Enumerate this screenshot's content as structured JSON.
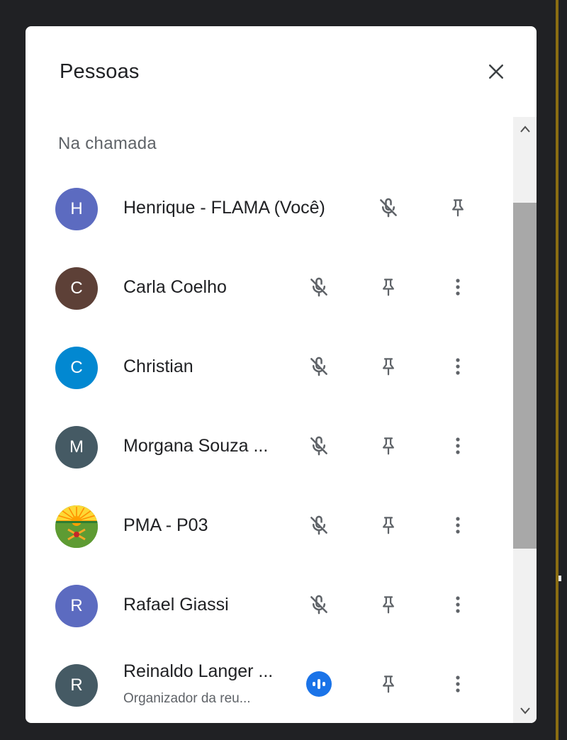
{
  "panel": {
    "title": "Pessoas",
    "section_label": "Na chamada"
  },
  "participants": [
    {
      "initial": "H",
      "name": "Henrique - FLAMA (Você)",
      "subtitle": "",
      "avatar_color": "#5c6bc0",
      "mic": "mic-off-icon",
      "has_more": false
    },
    {
      "initial": "C",
      "name": "Carla Coelho",
      "subtitle": "",
      "avatar_color": "#5d4037",
      "mic": "mic-off-icon",
      "has_more": true
    },
    {
      "initial": "C",
      "name": "Christian",
      "subtitle": "",
      "avatar_color": "#0288d1",
      "mic": "mic-off-icon",
      "has_more": true
    },
    {
      "initial": "M",
      "name": "Morgana Souza ...",
      "subtitle": "",
      "avatar_color": "#455a64",
      "mic": "mic-off-icon",
      "has_more": true
    },
    {
      "initial": "",
      "name": "PMA - P03",
      "subtitle": "",
      "avatar_color": "#5e9b33",
      "mic": "mic-off-icon",
      "has_more": true,
      "avatar_image": "emblem"
    },
    {
      "initial": "R",
      "name": "Rafael Giassi",
      "subtitle": "",
      "avatar_color": "#5c6bc0",
      "mic": "mic-off-icon",
      "has_more": true
    },
    {
      "initial": "R",
      "name": "Reinaldo Langer ...",
      "subtitle": "Organizador da reu...",
      "avatar_color": "#455a64",
      "mic": "speaking-icon",
      "has_more": true
    }
  ],
  "colors": {
    "icon": "#5f6368",
    "speaking": "#1a73e8",
    "scroll_thumb": "#a8a8a8"
  }
}
